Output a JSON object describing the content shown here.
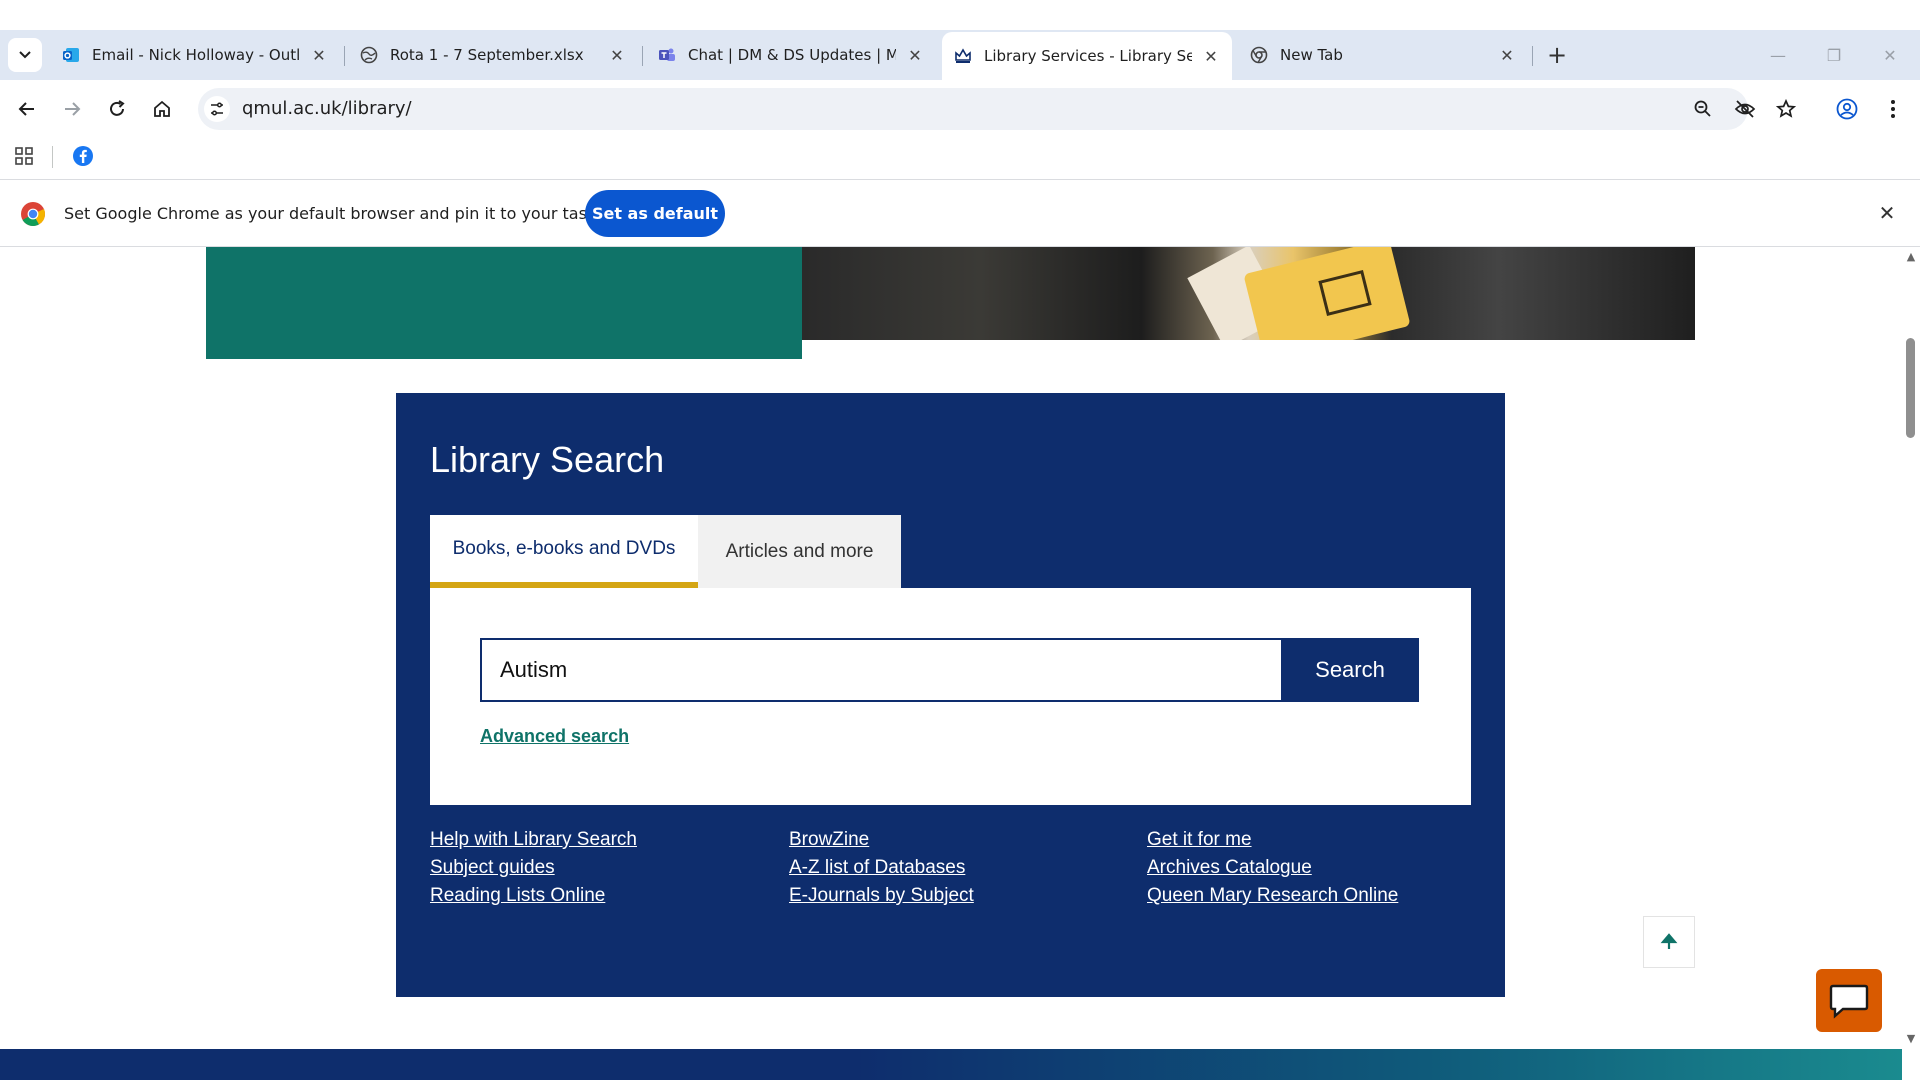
{
  "browser": {
    "tabs": [
      {
        "label": "Email - Nick Holloway - Outlook",
        "icon": "outlook-icon"
      },
      {
        "label": "Rota 1 - 7 September.xlsx",
        "icon": "globe-icon"
      },
      {
        "label": "Chat | DM & DS Updates | Microsoft Teams",
        "icon": "teams-icon"
      },
      {
        "label": "Library Services - Library Services",
        "icon": "crown-icon",
        "active": true
      },
      {
        "label": "New Tab",
        "icon": "chrome-icon"
      }
    ],
    "url": "qmul.ac.uk/library/",
    "infobar": {
      "message": "Set Google Chrome as your default browser and pin it to your taskbar",
      "button": "Set as default"
    }
  },
  "page": {
    "search": {
      "title": "Library Search",
      "tabs": [
        "Books, e-books and DVDs",
        "Articles and more"
      ],
      "query": "Autism",
      "button": "Search",
      "advanced": "Advanced search"
    },
    "links": {
      "col1": [
        "Help with Library Search",
        "Subject guides",
        "Reading Lists Online"
      ],
      "col2": [
        "BrowZine",
        "A-Z list of Databases",
        "E-Journals by Subject"
      ],
      "col3": [
        "Get it for me",
        "Archives Catalogue",
        "Queen Mary Research Online"
      ]
    }
  },
  "colors": {
    "panel": "#0e2d6d",
    "accent_green": "#0f7368",
    "tab_underline": "#d4a514",
    "chat": "#d95a00"
  }
}
